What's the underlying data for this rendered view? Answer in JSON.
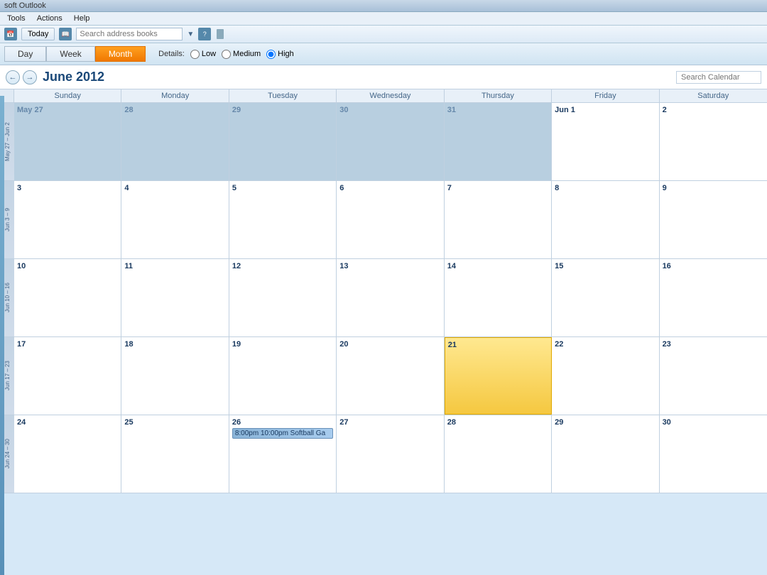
{
  "titleBar": {
    "text": "soft Outlook"
  },
  "menuBar": {
    "items": [
      "Tools",
      "Actions",
      "Help"
    ]
  },
  "toolbar": {
    "todayLabel": "Today",
    "searchPlaceholder": "Search address books",
    "iconLabel": "?"
  },
  "viewBar": {
    "tabs": [
      {
        "id": "day",
        "label": "Day",
        "active": false
      },
      {
        "id": "week",
        "label": "Week",
        "active": false
      },
      {
        "id": "month",
        "label": "Month",
        "active": true
      }
    ],
    "detailsLabel": "Details:",
    "detailOptions": [
      {
        "id": "low",
        "label": "Low",
        "checked": false
      },
      {
        "id": "medium",
        "label": "Medium",
        "checked": false
      },
      {
        "id": "high",
        "label": "High",
        "checked": true
      }
    ]
  },
  "calendar": {
    "title": "June 2012",
    "searchPlaceholder": "Search Calendar",
    "dayHeaders": [
      "Sunday",
      "Monday",
      "Tuesday",
      "Wednesday",
      "Thursday",
      "Friday",
      "Saturday"
    ],
    "weeks": [
      {
        "label": "May 27 – Jun 2",
        "days": [
          {
            "num": "May 27",
            "type": "prev-month"
          },
          {
            "num": "28",
            "type": "prev-month"
          },
          {
            "num": "29",
            "type": "prev-month"
          },
          {
            "num": "30",
            "type": "prev-month"
          },
          {
            "num": "31",
            "type": "prev-month"
          },
          {
            "num": "Jun 1",
            "type": "normal"
          },
          {
            "num": "2",
            "type": "normal"
          }
        ]
      },
      {
        "label": "Jun 3 – 9",
        "days": [
          {
            "num": "3",
            "type": "normal"
          },
          {
            "num": "4",
            "type": "normal"
          },
          {
            "num": "5",
            "type": "normal"
          },
          {
            "num": "6",
            "type": "normal"
          },
          {
            "num": "7",
            "type": "normal"
          },
          {
            "num": "8",
            "type": "normal"
          },
          {
            "num": "9",
            "type": "normal"
          }
        ]
      },
      {
        "label": "Jun 10 – 16",
        "days": [
          {
            "num": "10",
            "type": "normal"
          },
          {
            "num": "11",
            "type": "normal"
          },
          {
            "num": "12",
            "type": "normal"
          },
          {
            "num": "13",
            "type": "normal"
          },
          {
            "num": "14",
            "type": "normal"
          },
          {
            "num": "15",
            "type": "normal"
          },
          {
            "num": "16",
            "type": "normal"
          }
        ]
      },
      {
        "label": "Jun 17 – 23",
        "days": [
          {
            "num": "17",
            "type": "normal"
          },
          {
            "num": "18",
            "type": "normal"
          },
          {
            "num": "19",
            "type": "normal"
          },
          {
            "num": "20",
            "type": "normal"
          },
          {
            "num": "21",
            "type": "today"
          },
          {
            "num": "22",
            "type": "normal"
          },
          {
            "num": "23",
            "type": "normal"
          }
        ]
      },
      {
        "label": "Jun 24 – 30",
        "days": [
          {
            "num": "24",
            "type": "normal"
          },
          {
            "num": "25",
            "type": "normal"
          },
          {
            "num": "26",
            "type": "normal",
            "event": "8:00pm  10:00pm Softball Ga"
          },
          {
            "num": "27",
            "type": "normal"
          },
          {
            "num": "28",
            "type": "normal"
          },
          {
            "num": "29",
            "type": "normal"
          },
          {
            "num": "30",
            "type": "normal"
          }
        ]
      }
    ]
  }
}
